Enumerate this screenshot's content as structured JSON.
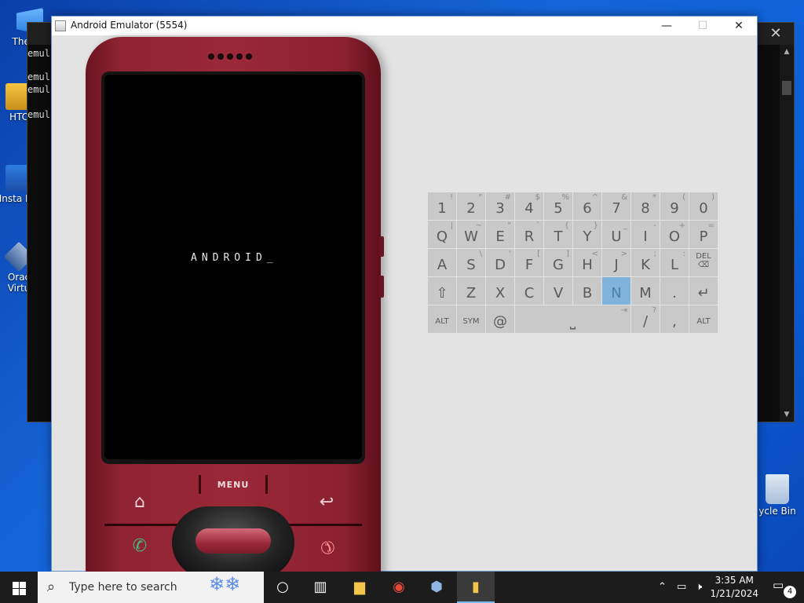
{
  "desktop": {
    "icons": [
      {
        "label": "Themul"
      },
      {
        "label": "HTC"
      },
      {
        "label": "Insta HA"
      },
      {
        "label": "Orac Virtu"
      },
      {
        "label": "ycle Bin"
      }
    ]
  },
  "console": {
    "lines": [
      "emul",
      "emul",
      "emul",
      "emul"
    ],
    "close_glyph": "✕"
  },
  "emulator": {
    "title": "Android Emulator (5554)",
    "minimize_glyph": "—",
    "maximize_glyph": "☐",
    "close_glyph": "✕",
    "phone": {
      "boot_text": "ANDROID_",
      "menu_label": "MENU",
      "home_glyph": "⌂",
      "back_glyph": "↩",
      "call_glyph": "✆",
      "end_glyph": "✆",
      "body_color": "#9a2838"
    },
    "keyboard": {
      "rows": [
        [
          {
            "m": "1",
            "s": "!"
          },
          {
            "m": "2",
            "s": "\""
          },
          {
            "m": "3",
            "s": "#"
          },
          {
            "m": "4",
            "s": "$"
          },
          {
            "m": "5",
            "s": "%"
          },
          {
            "m": "6",
            "s": "^"
          },
          {
            "m": "7",
            "s": "&"
          },
          {
            "m": "8",
            "s": "*"
          },
          {
            "m": "9",
            "s": "("
          },
          {
            "m": "0",
            "s": ")"
          }
        ],
        [
          {
            "m": "Q",
            "s": "|"
          },
          {
            "m": "W",
            "s": "~"
          },
          {
            "m": "E",
            "s": "\""
          },
          {
            "m": "R",
            "s": "`"
          },
          {
            "m": "T",
            "s": "{"
          },
          {
            "m": "Y",
            "s": "}"
          },
          {
            "m": "U",
            "s": "_"
          },
          {
            "m": "I",
            "s": "-"
          },
          {
            "m": "O",
            "s": "+"
          },
          {
            "m": "P",
            "s": "="
          }
        ],
        [
          {
            "m": "A",
            "s": ""
          },
          {
            "m": "S",
            "s": "\\"
          },
          {
            "m": "D",
            "s": "'"
          },
          {
            "m": "F",
            "s": "["
          },
          {
            "m": "G",
            "s": "]"
          },
          {
            "m": "H",
            "s": "<"
          },
          {
            "m": "J",
            "s": ">"
          },
          {
            "m": "K",
            "s": ";"
          },
          {
            "m": "L",
            "s": ":"
          },
          {
            "m": "DEL ⌫",
            "s": ""
          }
        ],
        [
          {
            "m": "⇧",
            "s": ""
          },
          {
            "m": "Z",
            "s": ""
          },
          {
            "m": "X",
            "s": ""
          },
          {
            "m": "C",
            "s": ""
          },
          {
            "m": "V",
            "s": ""
          },
          {
            "m": "B",
            "s": ""
          },
          {
            "m": "N",
            "s": ""
          },
          {
            "m": "M",
            "s": ""
          },
          {
            "m": ".",
            "s": ""
          },
          {
            "m": "↵",
            "s": ""
          }
        ],
        [
          {
            "m": "ALT",
            "s": ""
          },
          {
            "m": "SYM",
            "s": ""
          },
          {
            "m": "@",
            "s": ""
          },
          {
            "m": "⎵",
            "s": "⇥"
          },
          {
            "m": "/",
            "s": "?"
          },
          {
            "m": ",",
            "s": ""
          },
          {
            "m": "ALT",
            "s": ""
          }
        ]
      ],
      "highlighted": "N",
      "key_color": "#c9c9c9",
      "highlight_color": "#7fb3dd"
    }
  },
  "taskbar": {
    "search_placeholder": "Type here to search",
    "time": "3:35 AM",
    "date": "1/21/2024",
    "notification_count": "4",
    "accent": "#76b9ed"
  }
}
